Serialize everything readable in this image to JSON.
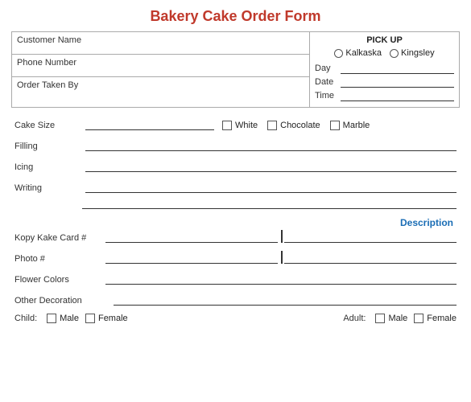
{
  "title": "Bakery Cake Order Form",
  "top": {
    "customerName": "Customer Name",
    "phoneNumber": "Phone Number",
    "orderTakenBy": "Order Taken By",
    "pickup": {
      "title": "PICK UP",
      "locations": [
        "Kalkaska",
        "Kingsley"
      ],
      "fields": [
        {
          "label": "Day"
        },
        {
          "label": "Date"
        },
        {
          "label": "Time"
        }
      ]
    }
  },
  "form": {
    "cakeSize": "Cake Size",
    "cakeOptions": [
      "White",
      "Chocolate",
      "Marble"
    ],
    "filling": "Filling",
    "icing": "Icing",
    "writing": "Writing",
    "descriptionLabel": "Description",
    "kopyKake": "Kopy Kake Card #",
    "photoNum": "Photo #",
    "flowerColors": "Flower Colors",
    "otherDecoration": "Other Decoration",
    "child": {
      "label": "Child:",
      "options": [
        "Male",
        "Female"
      ]
    },
    "adult": {
      "label": "Adult:",
      "options": [
        "Male",
        "Female"
      ]
    }
  }
}
